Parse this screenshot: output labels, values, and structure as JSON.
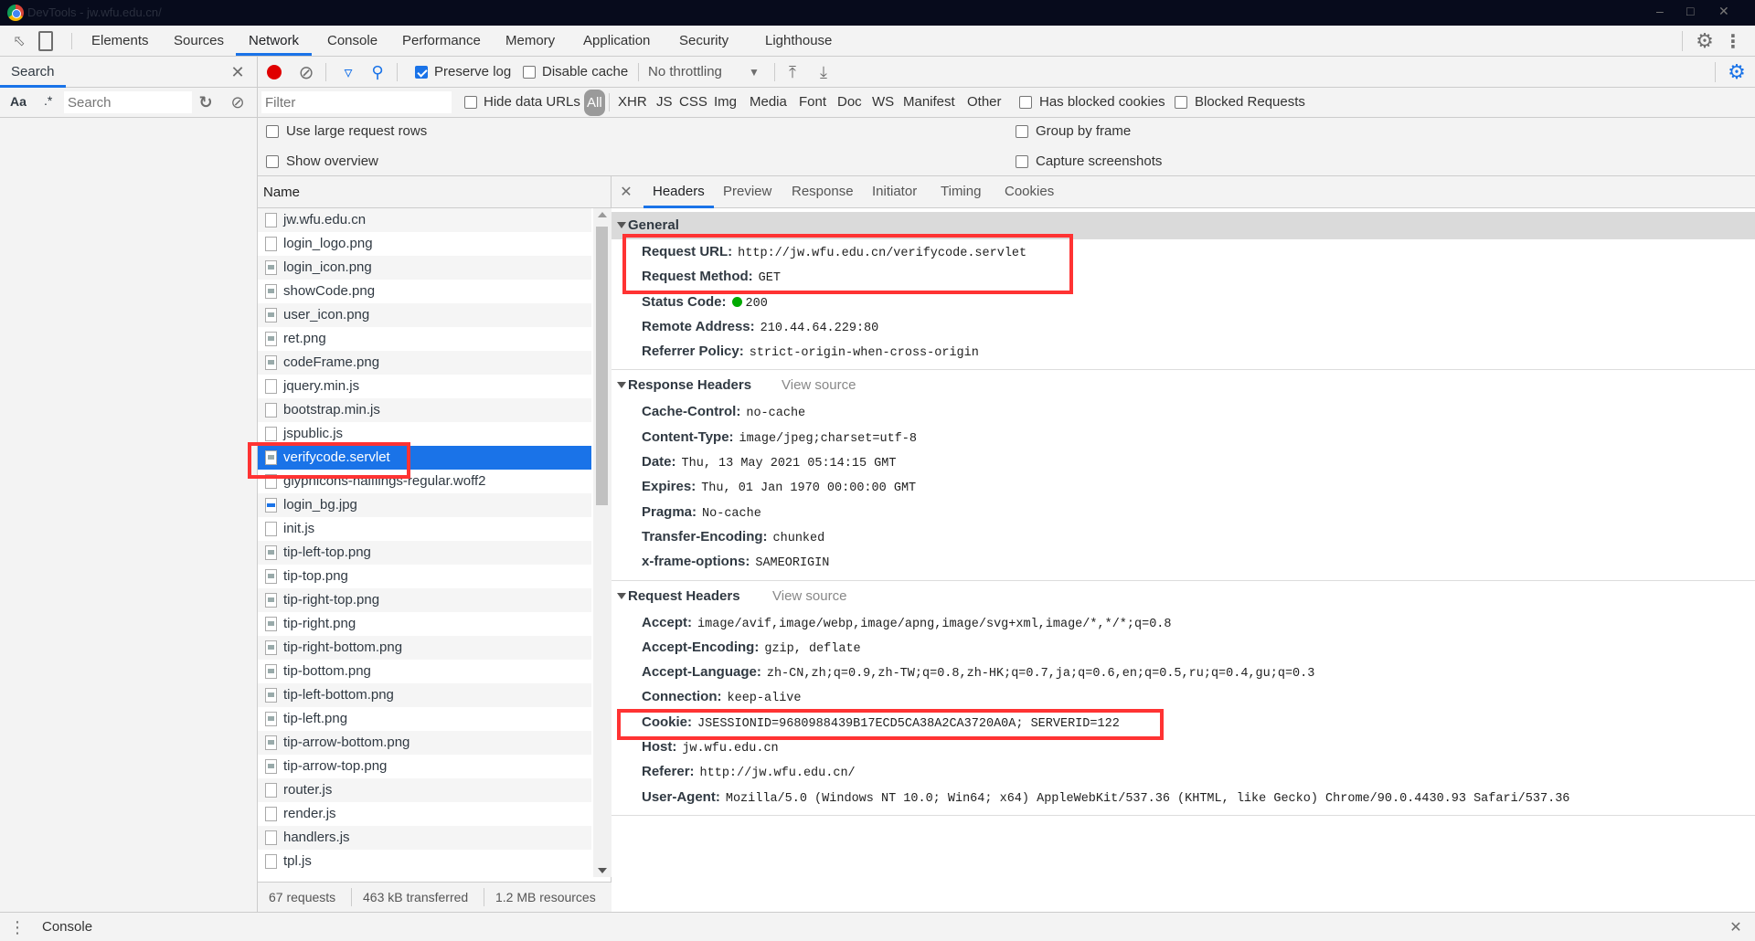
{
  "window": {
    "title": "DevTools - jw.wfu.edu.cn/"
  },
  "tabs": [
    {
      "label": "Elements"
    },
    {
      "label": "Sources"
    },
    {
      "label": "Network"
    },
    {
      "label": "Console"
    },
    {
      "label": "Performance"
    },
    {
      "label": "Memory"
    },
    {
      "label": "Application"
    },
    {
      "label": "Security"
    },
    {
      "label": "Lighthouse"
    }
  ],
  "search": {
    "title": "Search",
    "case_label": "Aa",
    "regex_label": ".*",
    "placeholder": "Search"
  },
  "toolbar": {
    "preserve_log": "Preserve log",
    "preserve_log_checked": true,
    "disable_cache": "Disable cache",
    "throttling": "No throttling"
  },
  "filter": {
    "placeholder": "Filter",
    "hide_data_urls": "Hide data URLs",
    "types": [
      "All",
      "XHR",
      "JS",
      "CSS",
      "Img",
      "Media",
      "Font",
      "Doc",
      "WS",
      "Manifest",
      "Other"
    ],
    "has_blocked_cookies": "Has blocked cookies",
    "blocked_requests": "Blocked Requests"
  },
  "options": {
    "large_rows": "Use large request rows",
    "show_overview": "Show overview",
    "group_by_frame": "Group by frame",
    "capture_screenshots": "Capture screenshots"
  },
  "requests": {
    "header": "Name",
    "items": [
      {
        "name": "jw.wfu.edu.cn",
        "icon": "doc"
      },
      {
        "name": "login_logo.png",
        "icon": "blank"
      },
      {
        "name": "login_icon.png",
        "icon": "img"
      },
      {
        "name": "showCode.png",
        "icon": "img"
      },
      {
        "name": "user_icon.png",
        "icon": "img"
      },
      {
        "name": "ret.png",
        "icon": "img"
      },
      {
        "name": "codeFrame.png",
        "icon": "img"
      },
      {
        "name": "jquery.min.js",
        "icon": "doc"
      },
      {
        "name": "bootstrap.min.js",
        "icon": "doc"
      },
      {
        "name": "jspublic.js",
        "icon": "doc"
      },
      {
        "name": "verifycode.servlet",
        "icon": "img",
        "selected": true
      },
      {
        "name": "glyphicons-halflings-regular.woff2",
        "icon": "blank"
      },
      {
        "name": "login_bg.jpg",
        "icon": "blue"
      },
      {
        "name": "init.js",
        "icon": "blank"
      },
      {
        "name": "tip-left-top.png",
        "icon": "img"
      },
      {
        "name": "tip-top.png",
        "icon": "img"
      },
      {
        "name": "tip-right-top.png",
        "icon": "img"
      },
      {
        "name": "tip-right.png",
        "icon": "img"
      },
      {
        "name": "tip-right-bottom.png",
        "icon": "img"
      },
      {
        "name": "tip-bottom.png",
        "icon": "img"
      },
      {
        "name": "tip-left-bottom.png",
        "icon": "img"
      },
      {
        "name": "tip-left.png",
        "icon": "img"
      },
      {
        "name": "tip-arrow-bottom.png",
        "icon": "img"
      },
      {
        "name": "tip-arrow-top.png",
        "icon": "img"
      },
      {
        "name": "router.js",
        "icon": "blank"
      },
      {
        "name": "render.js",
        "icon": "blank"
      },
      {
        "name": "handlers.js",
        "icon": "blank"
      },
      {
        "name": "tpl.js",
        "icon": "blank"
      }
    ]
  },
  "status": {
    "requests": "67 requests",
    "transferred": "463 kB transferred",
    "resources": "1.2 MB resources"
  },
  "detail_tabs": [
    "Headers",
    "Preview",
    "Response",
    "Initiator",
    "Timing",
    "Cookies"
  ],
  "general": {
    "title": "General",
    "rows": [
      {
        "k": "Request URL:",
        "v": "http://jw.wfu.edu.cn/verifycode.servlet"
      },
      {
        "k": "Request Method:",
        "v": "GET"
      },
      {
        "k": "Status Code:",
        "v": "200",
        "status_color": "#00aa00"
      },
      {
        "k": "Remote Address:",
        "v": "210.44.64.229:80"
      },
      {
        "k": "Referrer Policy:",
        "v": "strict-origin-when-cross-origin"
      }
    ]
  },
  "response_headers": {
    "title": "Response Headers",
    "view_source": "View source",
    "rows": [
      {
        "k": "Cache-Control:",
        "v": "no-cache"
      },
      {
        "k": "Content-Type:",
        "v": "image/jpeg;charset=utf-8"
      },
      {
        "k": "Date:",
        "v": "Thu, 13 May 2021 05:14:15 GMT"
      },
      {
        "k": "Expires:",
        "v": "Thu, 01 Jan 1970 00:00:00 GMT"
      },
      {
        "k": "Pragma:",
        "v": "No-cache"
      },
      {
        "k": "Transfer-Encoding:",
        "v": "chunked"
      },
      {
        "k": "x-frame-options:",
        "v": "SAMEORIGIN"
      }
    ]
  },
  "request_headers": {
    "title": "Request Headers",
    "view_source": "View source",
    "rows": [
      {
        "k": "Accept:",
        "v": "image/avif,image/webp,image/apng,image/svg+xml,image/*,*/*;q=0.8"
      },
      {
        "k": "Accept-Encoding:",
        "v": "gzip, deflate"
      },
      {
        "k": "Accept-Language:",
        "v": "zh-CN,zh;q=0.9,zh-TW;q=0.8,zh-HK;q=0.7,ja;q=0.6,en;q=0.5,ru;q=0.4,gu;q=0.3"
      },
      {
        "k": "Connection:",
        "v": "keep-alive"
      },
      {
        "k": "Cookie:",
        "v": "JSESSIONID=9680988439B17ECD5CA38A2CA3720A0A; SERVERID=122"
      },
      {
        "k": "Host:",
        "v": "jw.wfu.edu.cn"
      },
      {
        "k": "Referer:",
        "v": "http://jw.wfu.edu.cn/"
      },
      {
        "k": "User-Agent:",
        "v": "Mozilla/5.0 (Windows NT 10.0; Win64; x64) AppleWebKit/537.36 (KHTML, like Gecko) Chrome/90.0.4430.93 Safari/537.36"
      }
    ]
  },
  "drawer": {
    "console_label": "Console"
  },
  "colors": {
    "accent": "#1a73e8",
    "highlight_box": "#ff3333",
    "record": "#e00000"
  }
}
